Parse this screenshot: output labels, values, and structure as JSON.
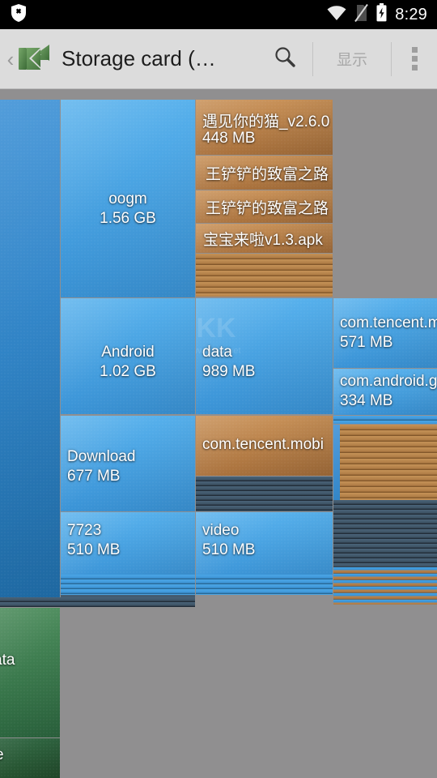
{
  "status_bar": {
    "notification_icon": "shield-block-icon",
    "wifi_icon": "wifi-icon",
    "sim_icon": "sim-card-off-icon",
    "battery_icon": "battery-charging-icon",
    "clock": "8:29"
  },
  "action_bar": {
    "up_caret": "‹",
    "app_icon": "diskusage-app-icon",
    "title": "Storage card (…",
    "search_icon": "search-icon",
    "show_label": "显示",
    "overflow_icon": "overflow-menu-icon"
  },
  "watermark": {
    "text": "KK",
    "url": "www.kkx.net"
  },
  "treemap": {
    "tiles": [
      {
        "name": "parent-blue-panel",
        "label": "",
        "size": "",
        "color": "#2f86c9"
      },
      {
        "name": "oogm",
        "label": "oogm",
        "size": "1.56 GB",
        "color": "#3f92d6"
      },
      {
        "name": "apk-1",
        "label": "遇见你的猫_v2.6.0",
        "size": "448 MB",
        "color": "#b07d46"
      },
      {
        "name": "apk-2",
        "label": "王铲铲的致富之路",
        "size": "",
        "color": "#b07d46"
      },
      {
        "name": "apk-3",
        "label": "王铲铲的致富之路",
        "size": "",
        "color": "#b07d46"
      },
      {
        "name": "apk-4",
        "label": "宝宝来啦v1.3.apk",
        "size": "",
        "color": "#b07d46"
      },
      {
        "name": "android",
        "label": "Android",
        "size": "1.02 GB",
        "color": "#3f92d6"
      },
      {
        "name": "data",
        "label": "data",
        "size": "989 MB",
        "color": "#3f92d6"
      },
      {
        "name": "com-tencent-m",
        "label": "com.tencent.m",
        "size": "571 MB",
        "color": "#3f92d6"
      },
      {
        "name": "com-android-g",
        "label": "com.android.g",
        "size": "334 MB",
        "color": "#3f92d6"
      },
      {
        "name": "download",
        "label": "Download",
        "size": "677 MB",
        "color": "#3f92d6"
      },
      {
        "name": "com-tencent-mobi",
        "label": "com.tencent.mobi",
        "size": "",
        "color": "#b07d46"
      },
      {
        "name": "dir-7723",
        "label": "7723",
        "size": "510 MB",
        "color": "#3f92d6"
      },
      {
        "name": "video",
        "label": "video",
        "size": "510 MB",
        "color": "#3f92d6"
      },
      {
        "name": "green-data",
        "label": "ata",
        "size": "",
        "color": "#2e6b42"
      },
      {
        "name": "green-free",
        "label": "e",
        "size": "",
        "color": "#25522f"
      }
    ]
  }
}
